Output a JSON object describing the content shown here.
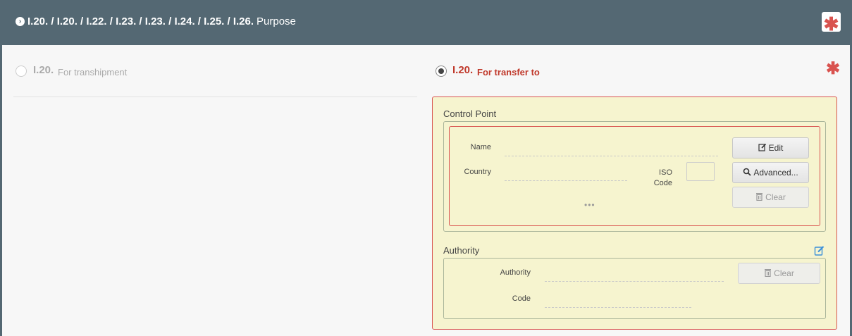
{
  "header": {
    "codes": "I.20. / I.20. / I.22. / I.23. / I.23. / I.24. / I.25. / I.26.",
    "title": "Purpose",
    "required_mark": "✱"
  },
  "options": {
    "left": {
      "code": "I.20.",
      "label": "For transhipment",
      "selected": false
    },
    "right": {
      "code": "I.20.",
      "label": "For transfer to",
      "selected": true
    }
  },
  "required_mark": "✱",
  "control_point": {
    "title": "Control Point",
    "name_label": "Name",
    "name_value": "",
    "country_label": "Country",
    "country_value": "",
    "iso_label": "ISO Code",
    "iso_value": "",
    "more": "•••",
    "edit_button": "Edit",
    "advanced_button": "Advanced...",
    "clear_button": "Clear"
  },
  "authority": {
    "title": "Authority",
    "authority_label": "Authority",
    "authority_value": "",
    "code_label": "Code",
    "code_value": "",
    "clear_button": "Clear"
  },
  "icons": {
    "chevron": "chevron-right-circle-icon",
    "edit": "edit-icon",
    "search": "search-icon",
    "trash": "trash-icon"
  },
  "colors": {
    "header_bg": "#546873",
    "required": "#d9534f",
    "selected_text": "#c0392b",
    "panel_bg": "#f6f4cf"
  }
}
